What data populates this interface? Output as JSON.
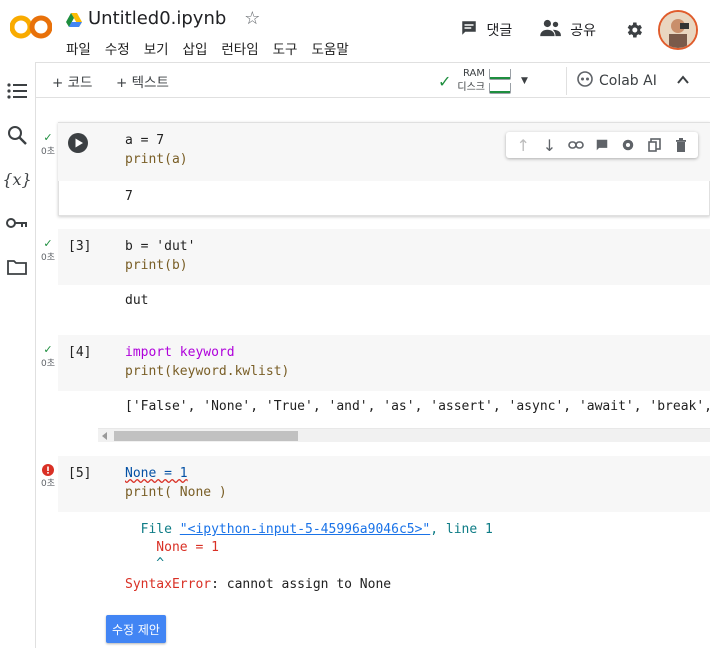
{
  "header": {
    "logo_text": "CO",
    "title": "Untitled0.ipynb",
    "menu": [
      "파일",
      "수정",
      "보기",
      "삽입",
      "런타임",
      "도구",
      "도움말"
    ],
    "comment_label": "댓글",
    "share_label": "공유"
  },
  "toolbar": {
    "add_code": "+ 코드",
    "add_text": "+ 텍스트",
    "ram_label": "RAM",
    "disk_label": "디스크",
    "colab_ai_label": "Colab AI"
  },
  "cells": [
    {
      "status_time": "0초",
      "code_lines": [
        "a = 7",
        "print(a)"
      ],
      "output_lines": [
        "7"
      ]
    },
    {
      "prompt": "[3]",
      "status_time": "0초",
      "code_lines": [
        "b = 'dut'",
        "print(b)"
      ],
      "output_lines": [
        "dut"
      ]
    },
    {
      "prompt": "[4]",
      "status_time": "0초",
      "code_lines": [
        "import keyword",
        "print(keyword.kwlist)"
      ],
      "output_lines": [
        "['False', 'None', 'True', 'and', 'as', 'assert', 'async', 'await', 'break', 'class', '"
      ]
    },
    {
      "prompt": "[5]",
      "status_time": "0초",
      "code_lines": [
        "None = 1",
        "print( None )"
      ],
      "error": {
        "file_prefix": "  File ",
        "file_link": "\"<ipython-input-5-45996a9046c5>\"",
        "file_suffix": ", line 1",
        "line_echo": "    None = 1",
        "caret": "    ^",
        "error_type": "SyntaxError",
        "error_message": ": cannot assign to None"
      },
      "suggest_button": "수정 제안"
    }
  ],
  "colors": {
    "success": "#1e8e3e",
    "error": "#d93025",
    "accent": "#4285f4"
  }
}
